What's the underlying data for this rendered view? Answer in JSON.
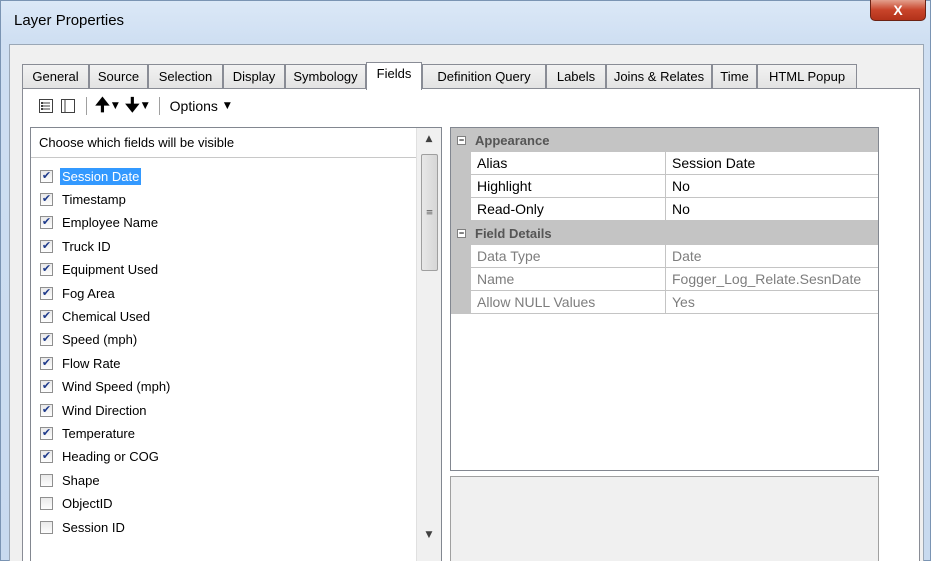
{
  "window": {
    "title": "Layer Properties",
    "close_glyph": "X"
  },
  "tabs": [
    {
      "label": "General"
    },
    {
      "label": "Source"
    },
    {
      "label": "Selection"
    },
    {
      "label": "Display"
    },
    {
      "label": "Symbology"
    },
    {
      "label": "Fields",
      "active": true
    },
    {
      "label": "Definition Query"
    },
    {
      "label": "Labels"
    },
    {
      "label": "Joins & Relates"
    },
    {
      "label": "Time"
    },
    {
      "label": "HTML Popup"
    }
  ],
  "toolbar": {
    "icons": [
      "list-detail-icon",
      "list-blank-icon",
      "arrow-up-icon",
      "arrow-down-icon"
    ],
    "options_label": "Options"
  },
  "fields_list": {
    "header": "Choose which fields will be visible",
    "items": [
      {
        "label": "Session Date",
        "checked": true,
        "selected": true
      },
      {
        "label": "Timestamp",
        "checked": true
      },
      {
        "label": "Employee Name",
        "checked": true
      },
      {
        "label": "Truck ID",
        "checked": true
      },
      {
        "label": "Equipment Used",
        "checked": true
      },
      {
        "label": "Fog Area",
        "checked": true
      },
      {
        "label": "Chemical Used",
        "checked": true
      },
      {
        "label": "Speed (mph)",
        "checked": true
      },
      {
        "label": "Flow Rate",
        "checked": true
      },
      {
        "label": "Wind Speed (mph)",
        "checked": true
      },
      {
        "label": "Wind Direction",
        "checked": true
      },
      {
        "label": "Temperature",
        "checked": true
      },
      {
        "label": "Heading or COG",
        "checked": true
      },
      {
        "label": "Shape",
        "checked": false
      },
      {
        "label": "ObjectID",
        "checked": false
      },
      {
        "label": "Session ID",
        "checked": false
      }
    ]
  },
  "properties": {
    "appearance": {
      "title": "Appearance",
      "rows": [
        {
          "name": "Alias",
          "value": "Session Date"
        },
        {
          "name": "Highlight",
          "value": "No"
        },
        {
          "name": "Read-Only",
          "value": "No"
        }
      ]
    },
    "field_details": {
      "title": "Field Details",
      "rows": [
        {
          "name": "Data Type",
          "value": "Date"
        },
        {
          "name": "Name",
          "value": "Fogger_Log_Relate.SesnDate"
        },
        {
          "name": "Allow NULL Values",
          "value": "Yes"
        }
      ]
    }
  },
  "colors": {
    "selection": "#3399ff",
    "category_band": "#c4c4c4",
    "close_button": "#c8442a"
  }
}
